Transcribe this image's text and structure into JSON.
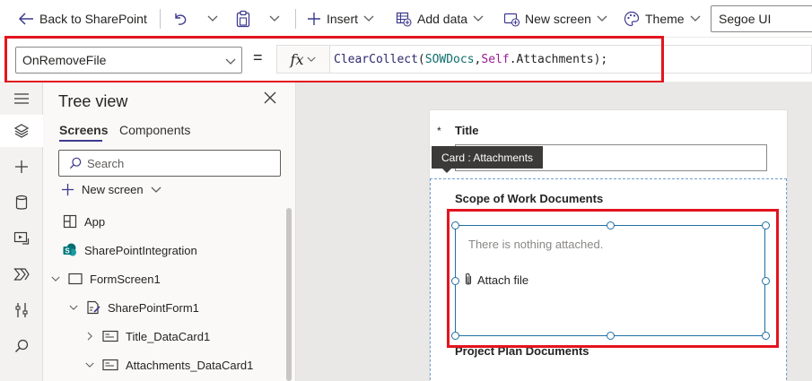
{
  "toolbar": {
    "back_label": "Back to SharePoint",
    "insert_label": "Insert",
    "add_data_label": "Add data",
    "new_screen_label": "New screen",
    "theme_label": "Theme",
    "font_value": "Segoe UI"
  },
  "formula_bar": {
    "property": "OnRemoveFile",
    "equals": "=",
    "fx": "fx",
    "formula_parts": {
      "fn": "ClearCollect",
      "open": "(",
      "collection": "SOWDocs",
      "comma": ",",
      "self": "Self",
      "rest": ".Attachments);"
    }
  },
  "tree_view": {
    "title": "Tree view",
    "tabs": [
      {
        "label": "Screens",
        "selected": true
      },
      {
        "label": "Components",
        "selected": false
      }
    ],
    "search_placeholder": "Search",
    "new_screen_label": "New screen",
    "items": [
      {
        "label": "App",
        "icon": "app-icon"
      },
      {
        "label": "SharePointIntegration",
        "icon": "sharepoint-icon"
      },
      {
        "label": "FormScreen1",
        "icon": "screen-icon",
        "expanded": true
      },
      {
        "label": "SharePointForm1",
        "icon": "form-icon",
        "expanded": true
      },
      {
        "label": "Title_DataCard1",
        "icon": "datacard-icon",
        "expanded": false
      },
      {
        "label": "Attachments_DataCard1",
        "icon": "datacard-icon",
        "expanded": true
      }
    ]
  },
  "canvas": {
    "required_mark": "*",
    "title_label": "Title",
    "card_tooltip": "Card : Attachments",
    "sow_label": "Scope of Work Documents",
    "nothing_attached": "There is nothing attached.",
    "attach_file": "Attach file",
    "project_plan_label": "Project Plan Documents"
  },
  "colors": {
    "accent": "#3c3a8e",
    "highlight_red": "#e3141e",
    "selection_blue": "#1f6fa5"
  }
}
